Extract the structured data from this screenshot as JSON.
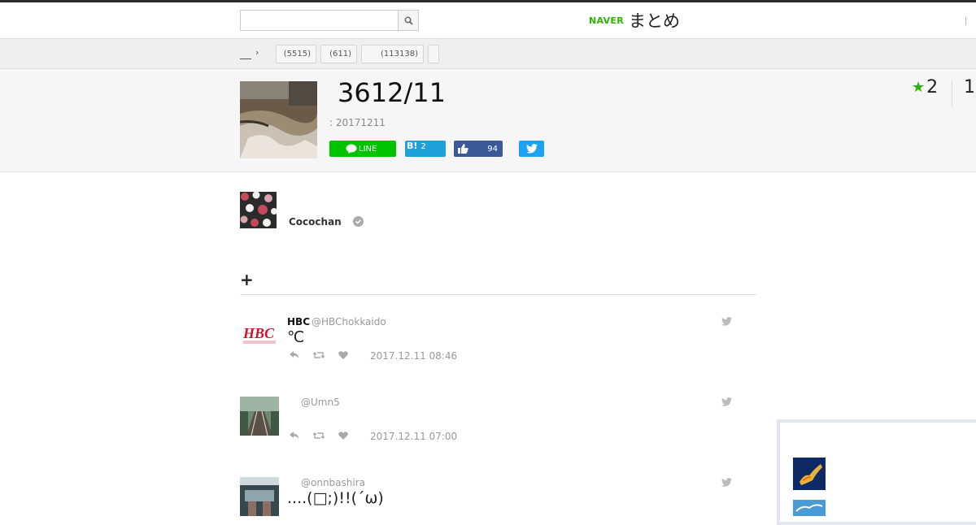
{
  "header": {
    "search_placeholder": "",
    "logo_brand": "NAVER",
    "logo_name": "まとめ"
  },
  "categories": {
    "items": [
      {
        "label": "(5515)"
      },
      {
        "label": "(611)"
      },
      {
        "label": "(113138)"
      },
      {
        "label": ""
      }
    ]
  },
  "article": {
    "title": "3612/11",
    "date": ": 20171211",
    "favorites": "2",
    "views": "1",
    "share": {
      "line_label": "LINE",
      "hatena_label": "B!",
      "hatena_count": "2",
      "fb_count": "94"
    }
  },
  "author": {
    "name": "Cocochan"
  },
  "section": {
    "heading": "+"
  },
  "tweets": [
    {
      "name": "HBC",
      "handle": "@HBChokkaido",
      "text": "℃",
      "time": "2017.12.11 08:46"
    },
    {
      "name": "",
      "handle": "@Umn5",
      "text": "",
      "time": "2017.12.11 07:00"
    },
    {
      "name": "",
      "handle": "@onnbashira",
      "text": "....(□;)!!(´ω)",
      "time": ""
    }
  ],
  "colors": {
    "naver_green": "#2db400",
    "line_green": "#00c300",
    "hatena_blue": "#1fa0d8",
    "facebook_blue": "#3b5998",
    "twitter_blue": "#1da1f2"
  }
}
